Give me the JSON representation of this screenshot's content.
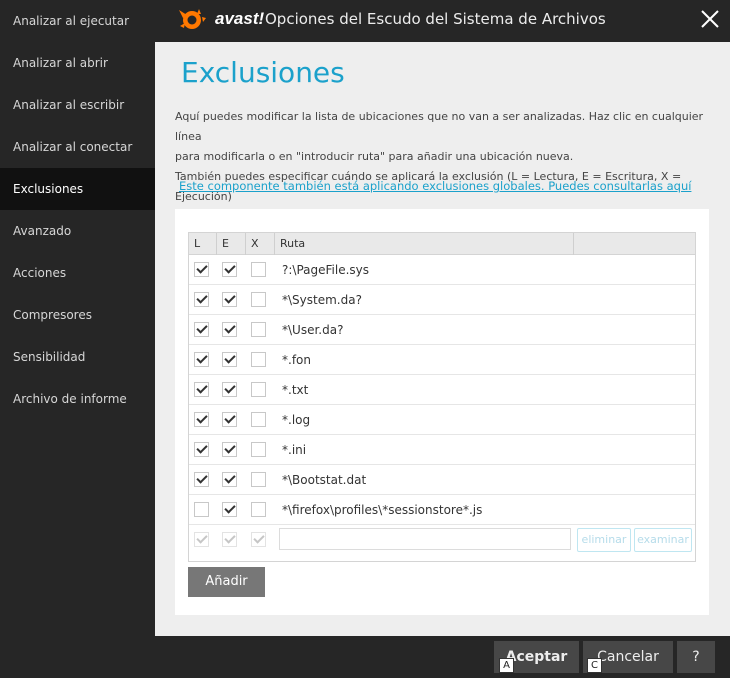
{
  "sidebar": {
    "items": [
      {
        "label": "Analizar al ejecutar"
      },
      {
        "label": "Analizar al abrir"
      },
      {
        "label": "Analizar al escribir"
      },
      {
        "label": "Analizar al conectar"
      },
      {
        "label": "Exclusiones",
        "active": true
      },
      {
        "label": "Avanzado"
      },
      {
        "label": "Acciones"
      },
      {
        "label": "Compresores"
      },
      {
        "label": "Sensibilidad"
      },
      {
        "label": "Archivo de informe"
      }
    ]
  },
  "titlebar": {
    "logo_text": "avast!",
    "title": "Opciones del Escudo del Sistema de Archivos",
    "close_icon": "close-icon",
    "logo_color": "#ff7800"
  },
  "main": {
    "title": "Exclusiones",
    "description_lines": [
      "Aquí puedes modificar la lista de ubicaciones que no van a ser analizadas. Haz clic en cualquier línea",
      "para modificarla o en \"introducir ruta\" para añadir una ubicación nueva.",
      "También puedes especificar cuándo se aplicará la exclusión (L = Lectura, E = Escritura, X = Ejecución)"
    ],
    "global_link": "Este componente también está aplicando exclusiones globales. Puedes consultarlas aquí",
    "accent_color": "#1ba1cb",
    "table": {
      "headers": {
        "l": "L",
        "e": "E",
        "x": "X",
        "path": "Ruta"
      },
      "rows": [
        {
          "l": true,
          "e": true,
          "x": false,
          "path": "?:\\PageFile.sys"
        },
        {
          "l": true,
          "e": true,
          "x": false,
          "path": "*\\System.da?"
        },
        {
          "l": true,
          "e": true,
          "x": false,
          "path": "*\\User.da?"
        },
        {
          "l": true,
          "e": true,
          "x": false,
          "path": "*.fon"
        },
        {
          "l": true,
          "e": true,
          "x": false,
          "path": "*.txt"
        },
        {
          "l": true,
          "e": true,
          "x": false,
          "path": "*.log"
        },
        {
          "l": true,
          "e": true,
          "x": false,
          "path": "*.ini"
        },
        {
          "l": true,
          "e": true,
          "x": false,
          "path": "*\\Bootstat.dat"
        },
        {
          "l": false,
          "e": true,
          "x": false,
          "path": "*\\firefox\\profiles\\*sessionstore*.js"
        }
      ],
      "new_row": {
        "path_value": "",
        "delete_label": "eliminar",
        "browse_label": "examinar"
      }
    },
    "add_label": "Añadir"
  },
  "footer": {
    "accept_label": "Aceptar",
    "accept_accel": "A",
    "cancel_label": "Cancelar",
    "cancel_accel": "C",
    "help_label": "?"
  }
}
